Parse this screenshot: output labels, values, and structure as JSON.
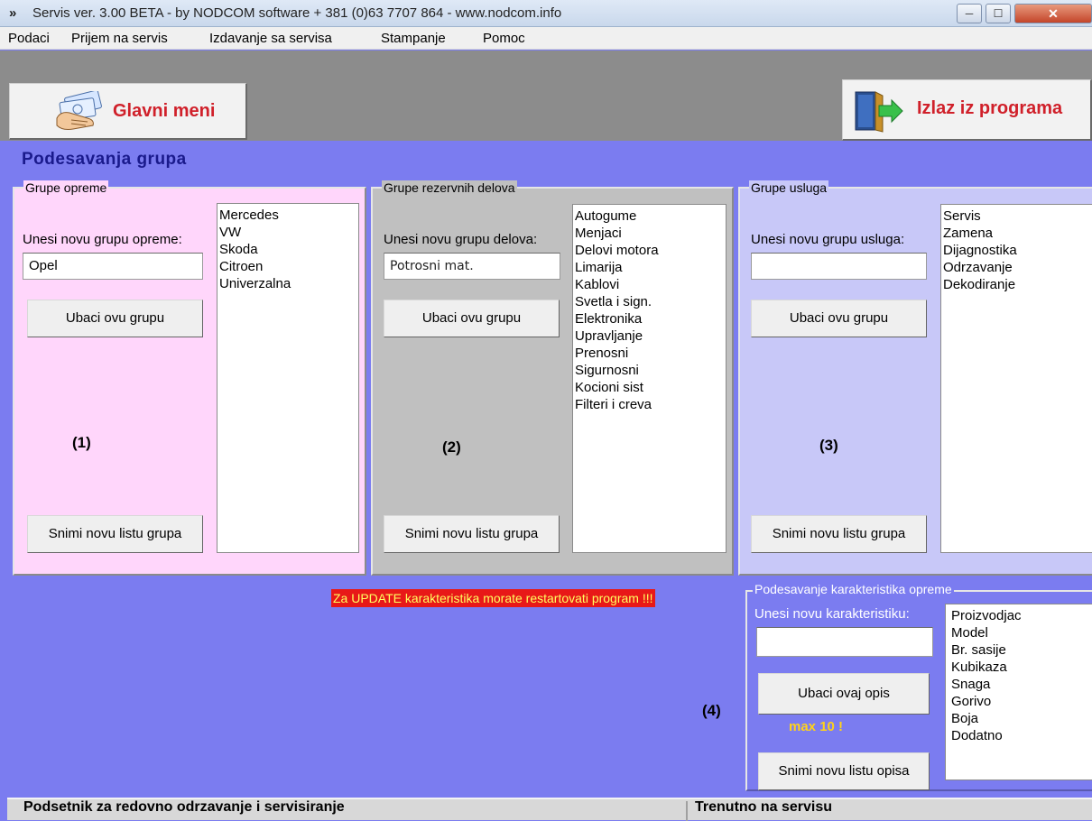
{
  "window": {
    "title": "Servis ver. 3.00 BETA - by NODCOM software  + 381 (0)63 7707 864 - www.nodcom.info",
    "app_icon": "»",
    "controls": {
      "minimize": "─",
      "maximize": "☐",
      "close": "✕"
    }
  },
  "menu": [
    "Podaci",
    "Prijem na servis",
    "Izdavanje sa servisa",
    "Stampanje",
    "Pomoc"
  ],
  "toolbar": {
    "main_menu_label": "Glavni meni",
    "exit_label": "Izlaz iz programa"
  },
  "page_title": "Podesavanja grupa",
  "panels": {
    "equipment": {
      "legend": "Grupe opreme",
      "input_label": "Unesi novu grupu opreme:",
      "input_value": "Opel",
      "insert_button": "Ubaci ovu grupu",
      "save_button": "Snimi novu listu grupa",
      "marker": "(1)",
      "items": [
        "Mercedes",
        "VW",
        "Skoda",
        "Citroen",
        "Univerzalna"
      ]
    },
    "parts": {
      "legend": "Grupe rezervnih delova",
      "input_label": "Unesi novu grupu delova:",
      "input_value": "Potrosni mat.",
      "insert_button": "Ubaci ovu grupu",
      "save_button": "Snimi novu listu grupa",
      "marker": "(2)",
      "items": [
        "Autogume",
        "Menjaci",
        "Delovi motora",
        "Limarija",
        "Kablovi",
        "Svetla i sign.",
        "Elektronika",
        "Upravljanje",
        "Prenosni",
        "Sigurnosni",
        "Kocioni sist",
        "Filteri i creva"
      ]
    },
    "services": {
      "legend": "Grupe usluga",
      "input_label": "Unesi novu grupu usluga:",
      "input_value": "",
      "insert_button": "Ubaci ovu grupu",
      "save_button": "Snimi novu listu grupa",
      "marker": "(3)",
      "items": [
        "Servis",
        "Zamena",
        "Dijagnostika",
        "Odrzavanje",
        "Dekodiranje"
      ]
    },
    "characteristics": {
      "legend": "Podesavanje karakteristika opreme",
      "input_label": "Unesi novu karakteristiku:",
      "input_value": "",
      "insert_button": "Ubaci ovaj opis",
      "save_button": "Snimi novu listu opisa",
      "max_note": "max 10 !",
      "marker": "(4)",
      "items": [
        "Proizvodjac",
        "Model",
        "Br. sasije",
        "Kubikaza",
        "Snaga",
        "Gorivo",
        "Boja",
        "Dodatno"
      ]
    }
  },
  "update_warning": "Za UPDATE karakteristika morate restartovati program !!!",
  "bottom": {
    "reminder_label": "Podsetnik za redovno odrzavanje i servisiranje",
    "current_label": "Trenutno na servisu"
  },
  "colors": {
    "main_bg": "#7b7cf0",
    "equipment_panel": "#ffd6fb",
    "parts_panel": "#c0c0c0",
    "services_panel": "#c8c8f8",
    "button_label_red": "#d0202a",
    "warning_bg": "#e81818",
    "warning_text": "#ffff60",
    "max_note": "#ffd21a",
    "title_blue": "#1a1a8c"
  }
}
